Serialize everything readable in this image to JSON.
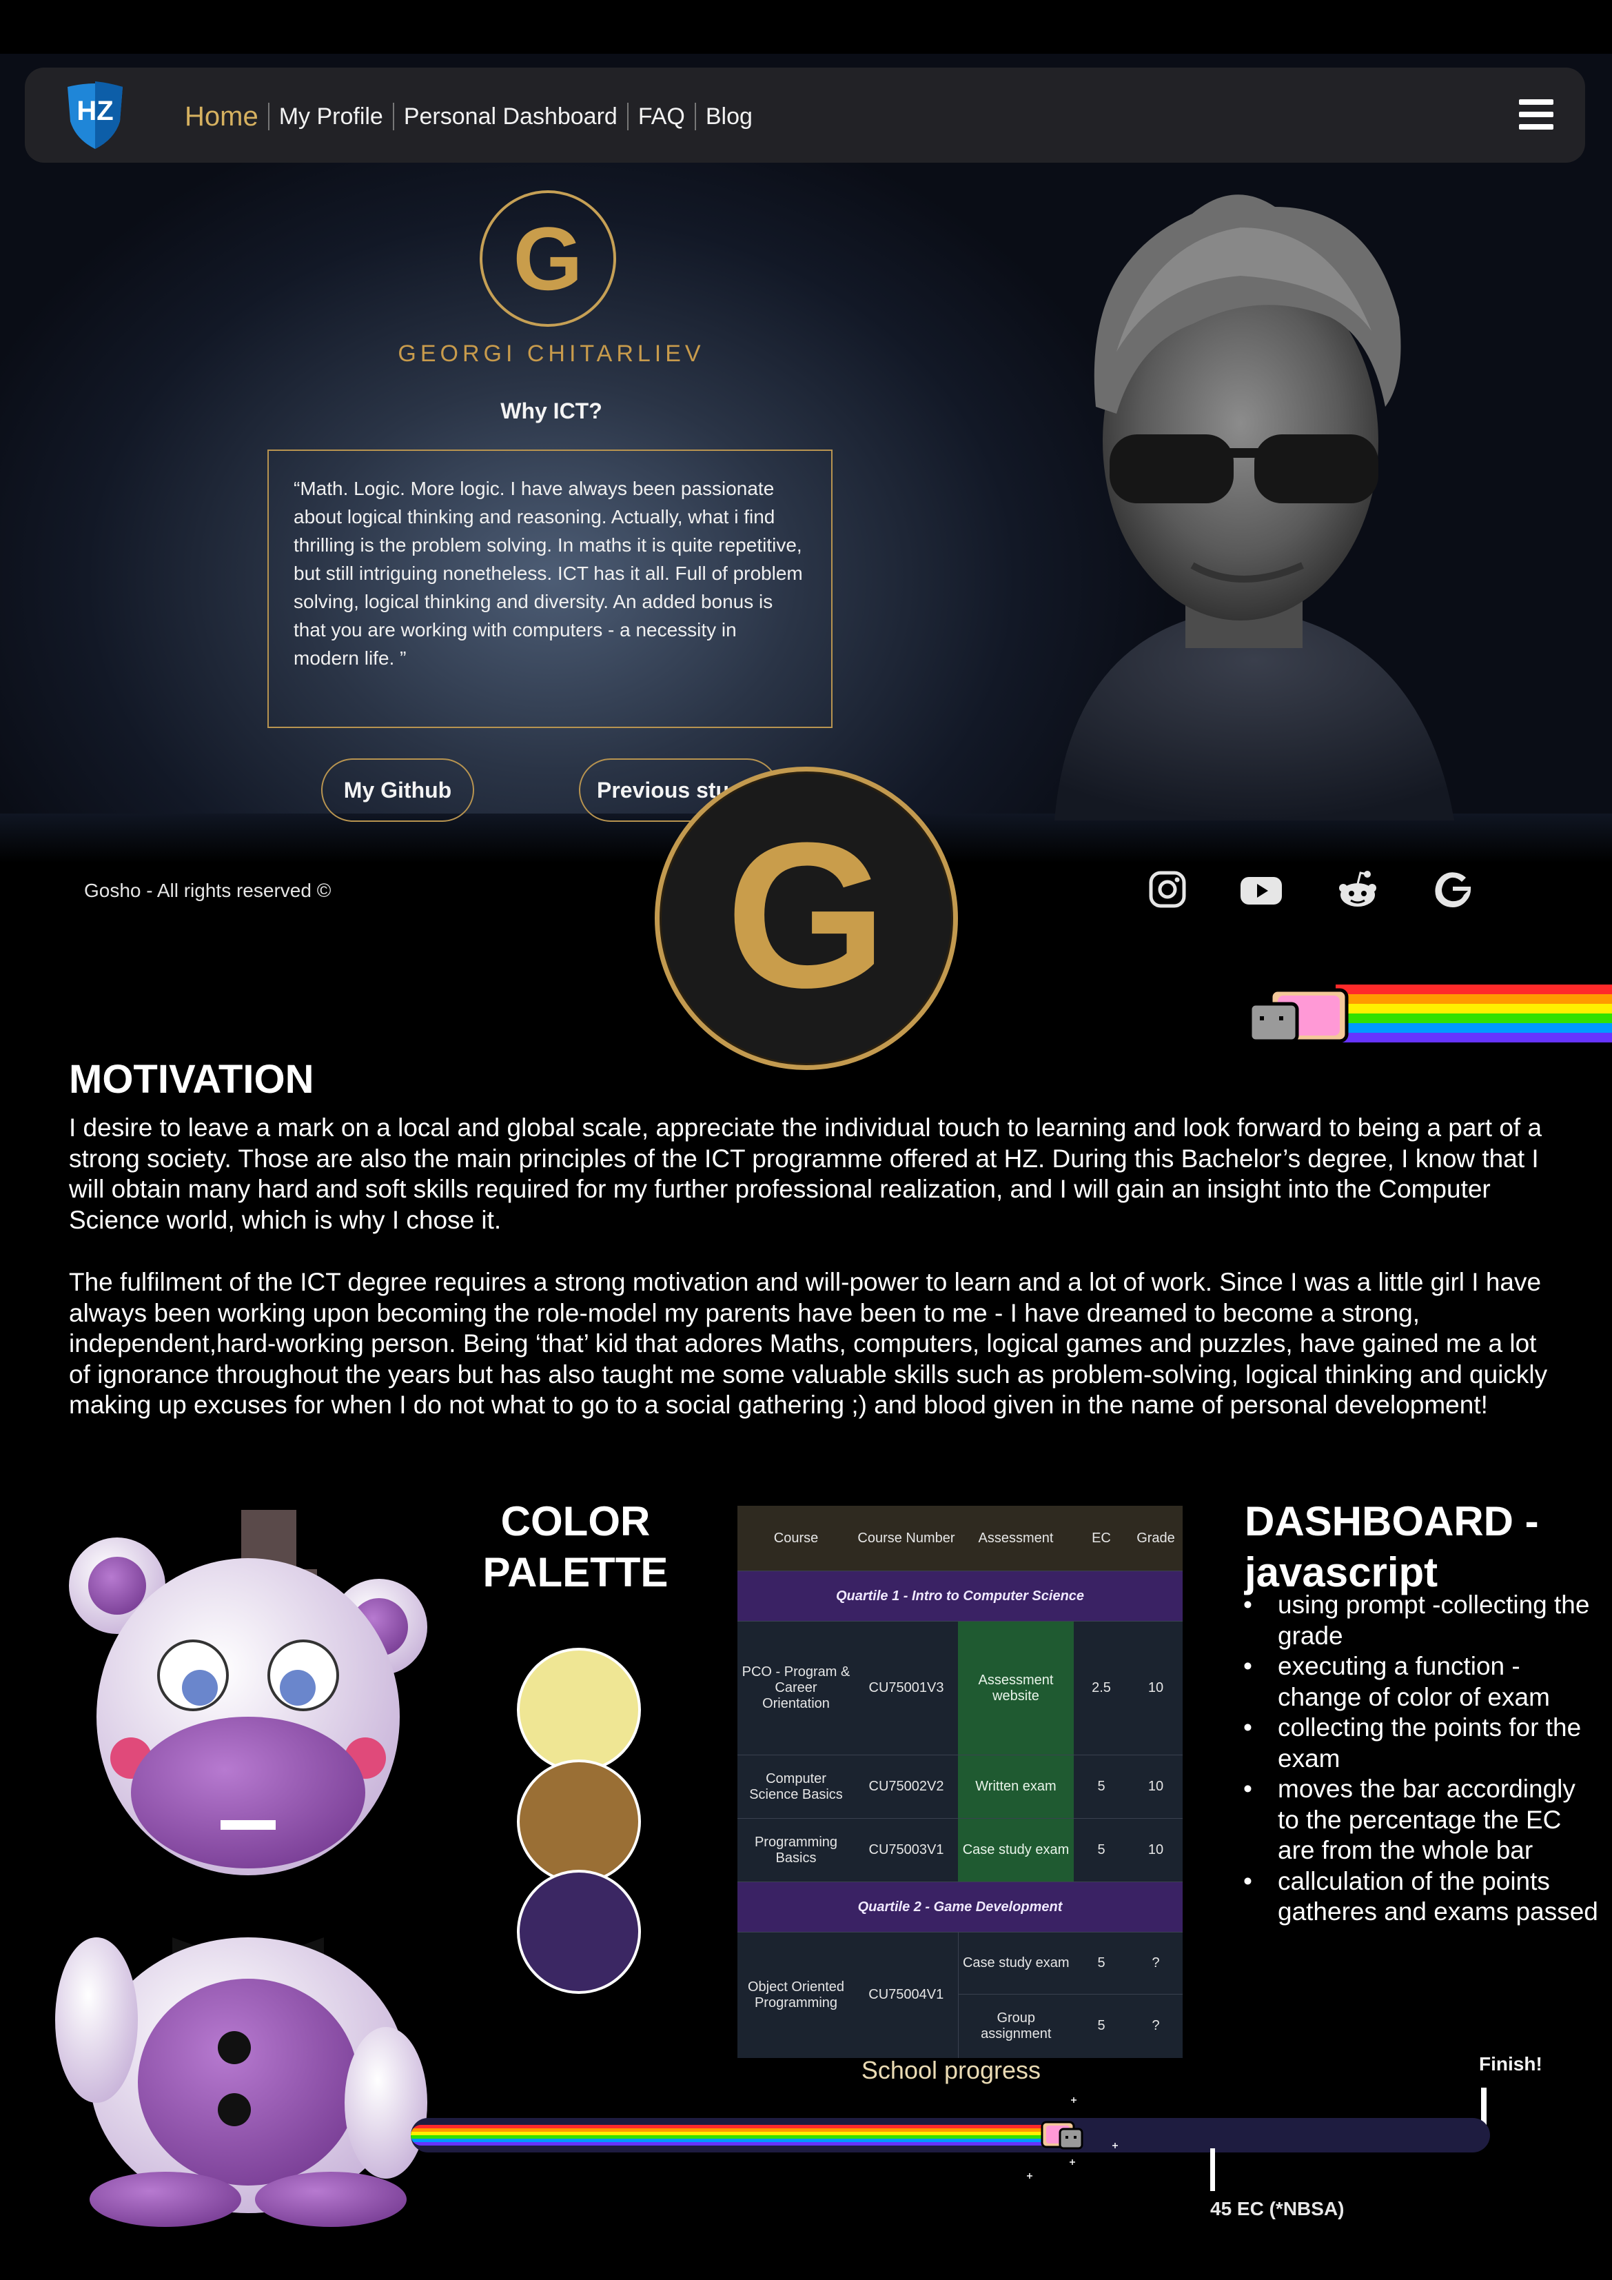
{
  "nav": {
    "logo_text": "HZ",
    "links": [
      "Home",
      "My Profile",
      "Personal Dashboard",
      "FAQ",
      "Blog"
    ],
    "active": "Home",
    "menu_icon": "hamburger-menu-icon"
  },
  "hero": {
    "monogram": "G",
    "name": "GEORGI CHITARLIEV",
    "why_title": "Why ICT?",
    "quote": "“Math. Logic. More logic. I have always been passionate about logical thinking and reasoning. Actually, what i find thrilling is the problem solving. In maths it is quite repetitive, but still intriguing nonetheless. ICT has it all. Full of problem solving, logical thinking and diversity. An added bonus is that you are working with computers - a necessity in modern life. ”",
    "buttons": [
      "My Github",
      "Previous stu"
    ]
  },
  "footer": {
    "copyright": "Gosho - All rights reserved ©",
    "social_icons": [
      "instagram-icon",
      "youtube-icon",
      "reddit-icon",
      "google-icon"
    ]
  },
  "logo_big": "G",
  "motivation": {
    "title": "MOTIVATION",
    "paragraphs": [
      "I desire to leave a mark on a local and global scale, appreciate the individual touch to learning and look forward to being a part of a strong society. Those are also the main principles of the ICT programme offered at HZ. During this Bachelor’s degree, I know that I will obtain many hard and soft skills required for my further professional realization, and I will gain an insight into the Computer Science world, which is why I chose it.",
      "The fulfilment of the ICT degree requires a strong motivation and will-power to learn and a lot of work. Since I was a little girl I have always been working upon becoming the role-model my parents have been to me - I have dreamed to become a strong, independent,hard-working person. Being ‘that’ kid that adores Maths, computers, logical games and puzzles, have gained me a lot of ignorance throughout the years but has also taught me some valuable skills such as problem-solving, logical thinking and quickly making up excuses for when I do not what to go to a social gathering ;) and blood given in the name of personal development!"
    ]
  },
  "palette": {
    "title_line1": "COLOR",
    "title_line2": "PALETTE",
    "colors": [
      "#efe694",
      "#9a6f35",
      "#3b2763"
    ]
  },
  "table": {
    "headers": [
      "Course",
      "Course Number",
      "Assessment",
      "EC",
      "Grade"
    ],
    "quartile1": "Quartile 1 - Intro to Computer Science",
    "quartile2": "Quartile 2 - Game Development",
    "rows": [
      {
        "course": "PCO - Program & Career Orientation",
        "number": "CU75001V3",
        "assessment": "Assessment website",
        "ec": "2.5",
        "grade": "10"
      },
      {
        "course": "Computer Science Basics",
        "number": "CU75002V2",
        "assessment": "Written exam",
        "ec": "5",
        "grade": "10"
      },
      {
        "course": "Programming Basics",
        "number": "CU75003V1",
        "assessment": "Case study exam",
        "ec": "5",
        "grade": "10"
      },
      {
        "course": "Object Oriented Programming",
        "number": "CU75004V1",
        "assessment": "Case study exam",
        "ec": "5",
        "grade": "?"
      },
      {
        "course": "",
        "number": "",
        "assessment": "Group assignment",
        "ec": "5",
        "grade": "?"
      }
    ]
  },
  "dashboard": {
    "title_line1": "DASHBOARD -",
    "title_line2": "javascript",
    "items": [
      "using prompt -collecting the grade",
      "executing a function - change of color of exam",
      "collecting the points for the exam",
      "moves the bar accordingly to the percentage the EC are from the whole bar",
      "callculation of the points gatheres and exams passed"
    ]
  },
  "progress": {
    "title": "School progress",
    "finish_label": "Finish!",
    "nbsa_label": "45 EC (*NBSA)",
    "fill_percent": 60
  }
}
